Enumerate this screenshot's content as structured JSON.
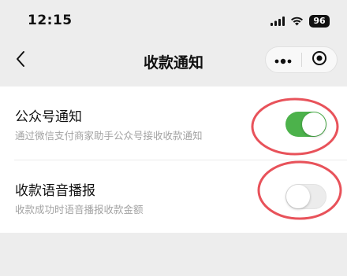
{
  "status_bar": {
    "time": "12:15",
    "battery": "96"
  },
  "nav": {
    "title": "收款通知"
  },
  "settings": [
    {
      "title": "公众号通知",
      "description": "通过微信支付商家助手公众号接收收款通知",
      "enabled": true
    },
    {
      "title": "收款语音播报",
      "description": "收款成功时语音播报收款金额",
      "enabled": false
    }
  ],
  "colors": {
    "toggle_on": "#4cb24b",
    "annotation": "#e8525a",
    "background": "#ededed"
  },
  "icons": {
    "back": "chevron-left-icon",
    "more": "more-dots-icon",
    "close": "target-circle-icon",
    "signal": "signal-bars-icon",
    "wifi": "wifi-icon"
  }
}
